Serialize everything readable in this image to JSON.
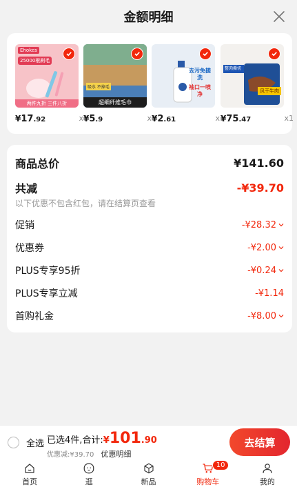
{
  "header": {
    "title": "金额明细"
  },
  "products": [
    {
      "price_cur": "¥",
      "price_int": "17",
      "price_dec": ".92",
      "qty": "x1",
      "badge_text": "Ehokes",
      "caption": "25000根刷毛",
      "sub": "两件九折 三件八折",
      "bg": "#f7c3c8"
    },
    {
      "price_cur": "¥",
      "price_int": "5",
      "price_dec": ".9",
      "qty": "x1",
      "caption": "超细纤维毛巾",
      "sub": "吸水 不掉毛",
      "bg": "#6ba3a7"
    },
    {
      "price_cur": "¥",
      "price_int": "2",
      "price_dec": ".61",
      "qty": "x1",
      "caption": "去污免搓洗",
      "sub": "袖口一喷净",
      "bg": "#e8eef5"
    },
    {
      "price_cur": "¥",
      "price_int": "75",
      "price_dec": ".47",
      "qty": "x1",
      "caption": "风干牛肉",
      "sub": "整肉撕切",
      "bg": "#f3f1ee"
    }
  ],
  "summary": {
    "total_label": "商品总价",
    "total_value": "¥141.60",
    "reduce_label": "共减",
    "reduce_value": "-¥39.70",
    "note": "以下优惠不包含红包，请在结算页查看",
    "items": [
      {
        "label": "促销",
        "value": "-¥28.32"
      },
      {
        "label": "优惠券",
        "value": "-¥2.00"
      },
      {
        "label": "PLUS专享95折",
        "value": "-¥0.24"
      },
      {
        "label": "PLUS专享立减",
        "value": "-¥1.14"
      },
      {
        "label": "首购礼金",
        "value": "-¥8.00"
      }
    ]
  },
  "checkout": {
    "select_all": "全选",
    "selected": "已选4件,合计:",
    "cur": "¥",
    "int": "101",
    "dec": ".90",
    "discount": "优惠减:¥39.70",
    "detail_link": "优惠明细",
    "button": "去结算"
  },
  "tabs": [
    {
      "label": "首页",
      "icon": "home-icon"
    },
    {
      "label": "逛",
      "icon": "face-icon"
    },
    {
      "label": "新品",
      "icon": "cube-icon"
    },
    {
      "label": "购物车",
      "icon": "cart-icon",
      "badge": "10"
    },
    {
      "label": "我的",
      "icon": "user-icon"
    }
  ],
  "colors": {
    "accent": "#f2270c"
  }
}
